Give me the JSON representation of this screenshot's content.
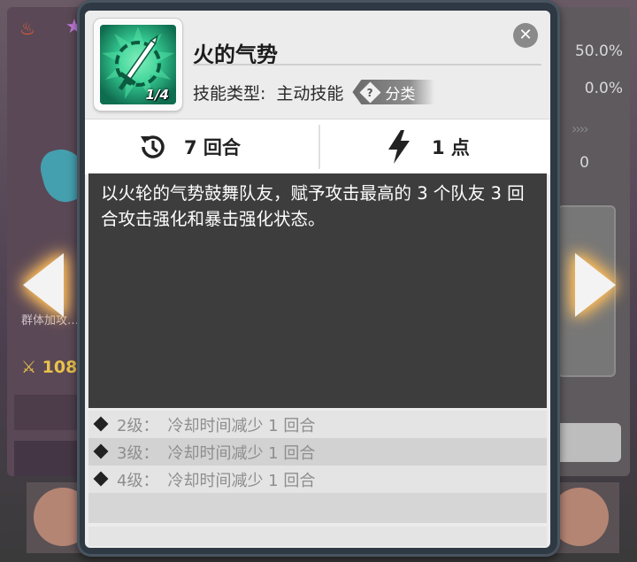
{
  "background": {
    "left_panel": {
      "power_value": "108",
      "skill_hint": "群体加攻…"
    },
    "right_panel": {
      "stat_1": "50.0%",
      "stat_2": "0.0%",
      "stat_3": "0"
    }
  },
  "dialog": {
    "skill_name": "火的气势",
    "level_badge": "1/4",
    "type_label": "技能类型:",
    "type_value": "主动技能",
    "tag_icon": "?",
    "tag_label": "分类",
    "cooldown": "7 回合",
    "cost": "1 点",
    "description": "以火轮的气势鼓舞队友，赋予攻击最高的 3 个队友 3 回合攻击强化和暴击强化状态。",
    "levels": [
      {
        "label": "2级：",
        "effect": "冷却时间减少 1 回合"
      },
      {
        "label": "3级：",
        "effect": "冷却时间减少 1 回合"
      },
      {
        "label": "4级：",
        "effect": "冷却时间减少 1 回合"
      }
    ],
    "close_symbol": "✕"
  },
  "colors": {
    "dialog_frame": "#2f3944",
    "description_bg": "#3d3d3d",
    "skill_icon_bg": "#1f9a72",
    "arrow_glow": "#ffb14a"
  },
  "icons": {
    "cooldown": "clock-rewind-icon",
    "cost": "lightning-icon",
    "skill": "flaming-sword-icon",
    "close": "close-icon"
  }
}
